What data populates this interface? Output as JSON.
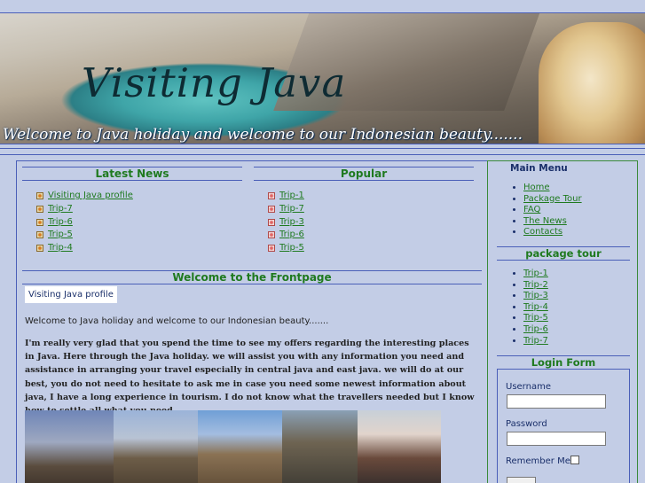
{
  "header": {
    "title": "Visiting Java",
    "tagline": "Welcome to Java holiday and welcome to our Indonesian beauty......."
  },
  "latest_news": {
    "heading": "Latest News",
    "items": [
      "Visiting Java profile",
      "Trip-7",
      "Trip-6",
      "Trip-5",
      "Trip-4"
    ]
  },
  "popular": {
    "heading": "Popular",
    "items": [
      "Trip-1",
      "Trip-7",
      "Trip-3",
      "Trip-6",
      "Trip-5"
    ]
  },
  "article": {
    "heading": "Welcome to the Frontpage",
    "tab_label": "Visiting Java profile",
    "intro": "Welcome to Java holiday and welcome to our Indonesian beauty.......",
    "body": "I'm really very glad that you spend the time to see my offers regarding the interesting places in Java. Here through the Java holiday. we will assist you with any information you need and assistance in arranging your travel especially in central java and east java. we will do at our best, you do not need to hesitate to ask me in case you need some newest information about java, I have a long experience in tourism. I do not know what the travellers needed but I know how to settle all what you need."
  },
  "main_menu": {
    "heading": "Main Menu",
    "items": [
      "Home",
      "Package Tour",
      "FAQ",
      "The News",
      "Contacts"
    ]
  },
  "package_tour": {
    "heading": "package tour",
    "items": [
      "Trip-1",
      "Trip-2",
      "Trip-3",
      "Trip-4",
      "Trip-5",
      "Trip-6",
      "Trip-7"
    ]
  },
  "login": {
    "heading": "Login Form",
    "username_label": "Username",
    "password_label": "Password",
    "remember_label": "Remember Me"
  },
  "colors": {
    "background": "#c3cde6",
    "link": "#1f7a1f",
    "border": "#4a5fb8",
    "heading_blue": "#1a2f6a"
  }
}
